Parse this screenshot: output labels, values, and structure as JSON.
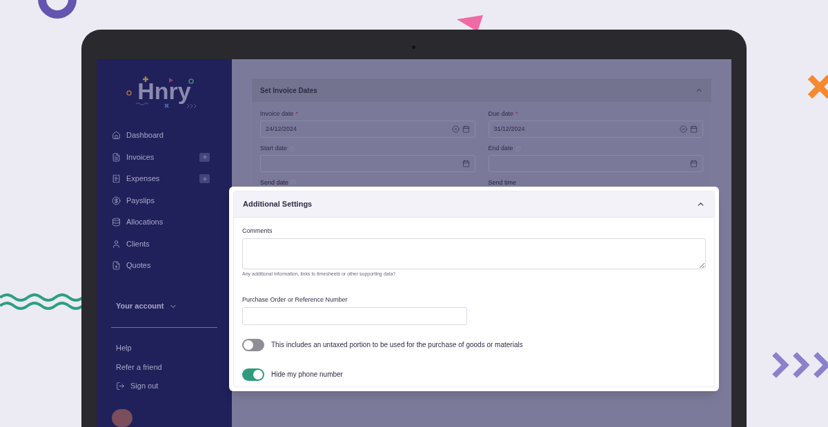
{
  "sidebar": {
    "logo": "Hnry",
    "nav_items": [
      {
        "label": "Dashboard",
        "add_button": false
      },
      {
        "label": "Invoices",
        "add_button": true
      },
      {
        "label": "Expenses",
        "add_button": true
      },
      {
        "label": "Payslips",
        "add_button": false
      },
      {
        "label": "Allocations",
        "add_button": false
      },
      {
        "label": "Clients",
        "add_button": false
      },
      {
        "label": "Quotes",
        "add_button": false
      }
    ],
    "account_menu": {
      "label": "Your account",
      "expanded": false
    },
    "footer_links": [
      {
        "label": "Help",
        "kind": "plain"
      },
      {
        "label": "Refer a friend",
        "kind": "plain"
      },
      {
        "label": "Sign out",
        "kind": "signout"
      }
    ]
  },
  "invoice_dates": {
    "title": "Set Invoice Dates",
    "expanded": true,
    "fields": [
      {
        "label": "Invoice date",
        "required_mark": "*",
        "info": false,
        "value": "24/12/2024"
      },
      {
        "label": "Due date",
        "required_mark": "*",
        "info": false,
        "value": "31/12/2024"
      },
      {
        "label": "Start date",
        "info": true
      },
      {
        "label": "End date",
        "info": true
      }
    ],
    "cut_off_labels": [
      {
        "label": "Send date",
        "info": true
      },
      {
        "label": "Send time",
        "info": false
      }
    ]
  },
  "additional_settings": {
    "title": "Additional Settings",
    "expanded": true,
    "comments": {
      "label": "Comments",
      "help": "Any additional information, links to timesheets or other supporting data?"
    },
    "reference": {
      "label": "Purchase Order or Reference Number"
    },
    "toggles": [
      {
        "label": "This includes an untaxed portion to be used for the purchase of goods or materials",
        "on": false
      },
      {
        "label": "Hide my phone number",
        "on": true
      }
    ]
  }
}
